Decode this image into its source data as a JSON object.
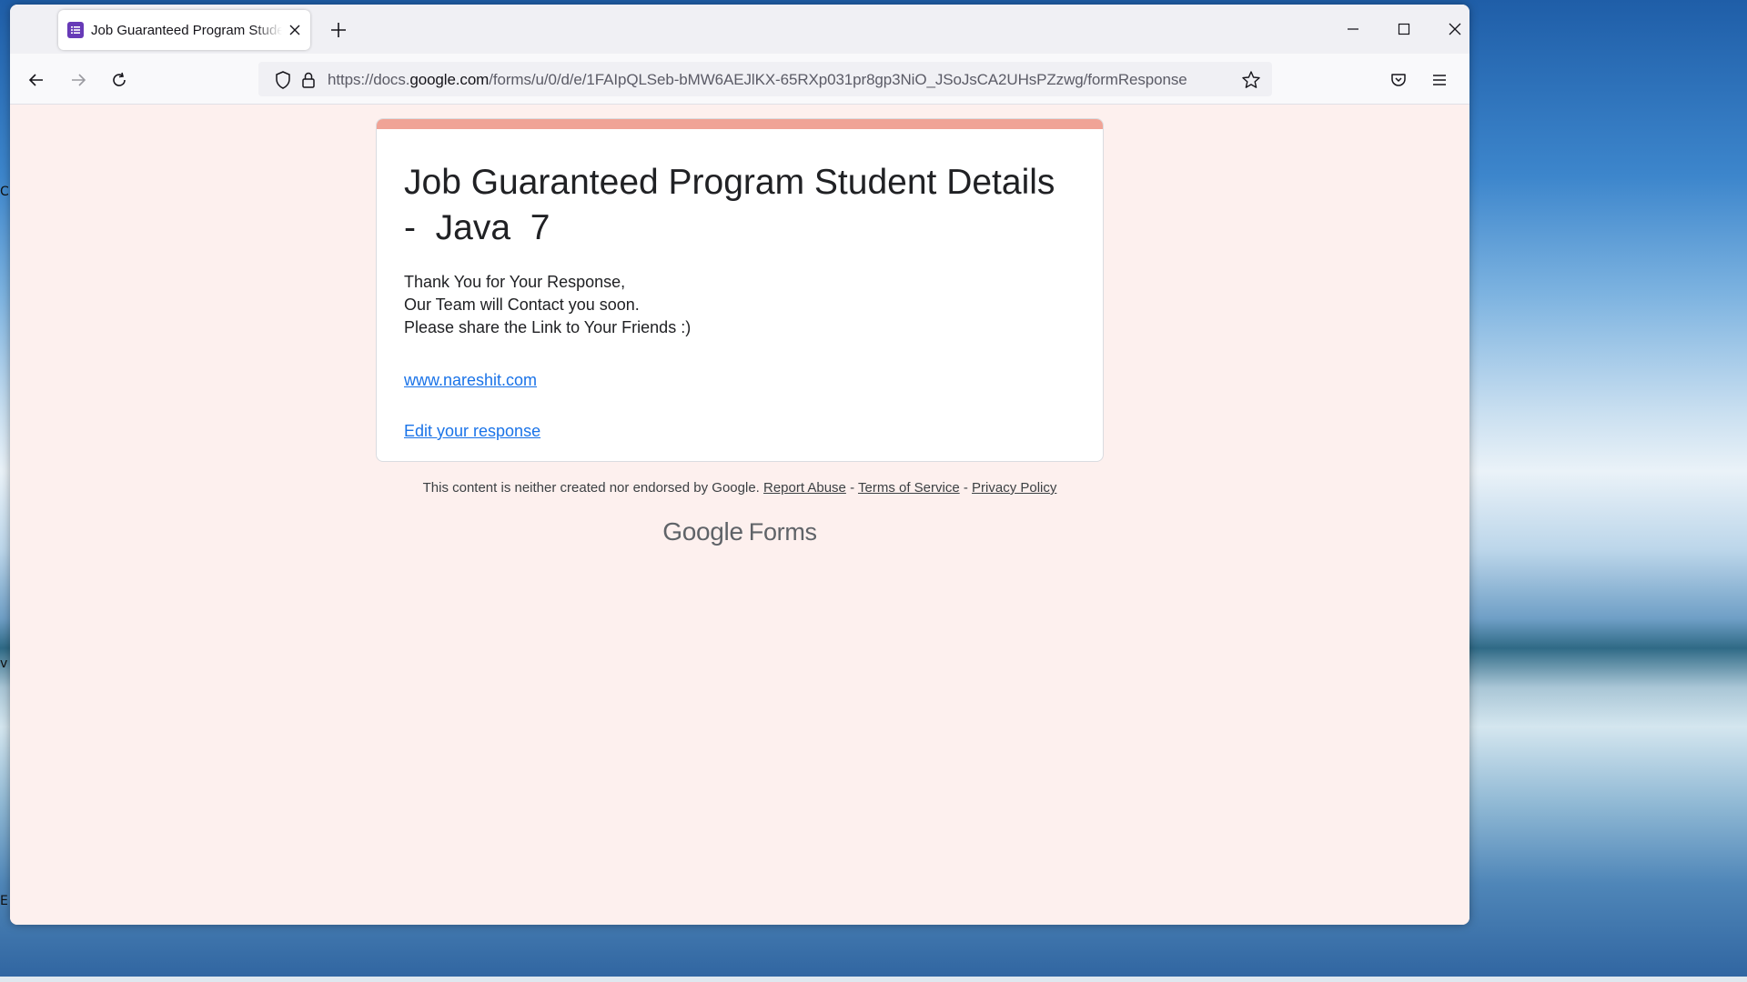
{
  "browser": {
    "tab_title": "Job Guaranteed Program Student Details",
    "url_prefix": "https://docs.",
    "url_domain": "google.com",
    "url_path": "/forms/u/0/d/e/1FAIpQLSeb-bMW6AEJlKX-65RXp031pr8gp3NiO_JSoJsCA2UHsPZzwg/formResponse",
    "icons": {
      "favicon": "google-forms-icon",
      "tab_close": "close-icon",
      "new_tab": "plus-icon",
      "minimize": "minimize-icon",
      "maximize": "maximize-icon",
      "close_window": "close-icon",
      "back": "arrow-left-icon",
      "forward": "arrow-right-icon",
      "reload": "reload-icon",
      "tracking": "shield-icon",
      "lock": "lock-icon",
      "bookmark": "star-icon",
      "pocket": "pocket-icon",
      "menu": "hamburger-menu-icon"
    }
  },
  "form": {
    "title": "Job Guaranteed Program Student Details  -  Java  7",
    "confirmation_lines": [
      "Thank You for Your Response,",
      "Our Team will Contact you soon.",
      "Please share the Link to Your Friends :)"
    ],
    "website_link": "www.nareshit.com",
    "edit_link": "Edit your response",
    "accent_color": "#f0a396",
    "background_color": "#fdf0ee"
  },
  "footer": {
    "disclaimer": "This content is neither created nor endorsed by Google.",
    "report_abuse": "Report Abuse",
    "separator": "-",
    "terms": "Terms of Service",
    "privacy": "Privacy Policy",
    "brand_google": "Google",
    "brand_forms": "Forms"
  }
}
